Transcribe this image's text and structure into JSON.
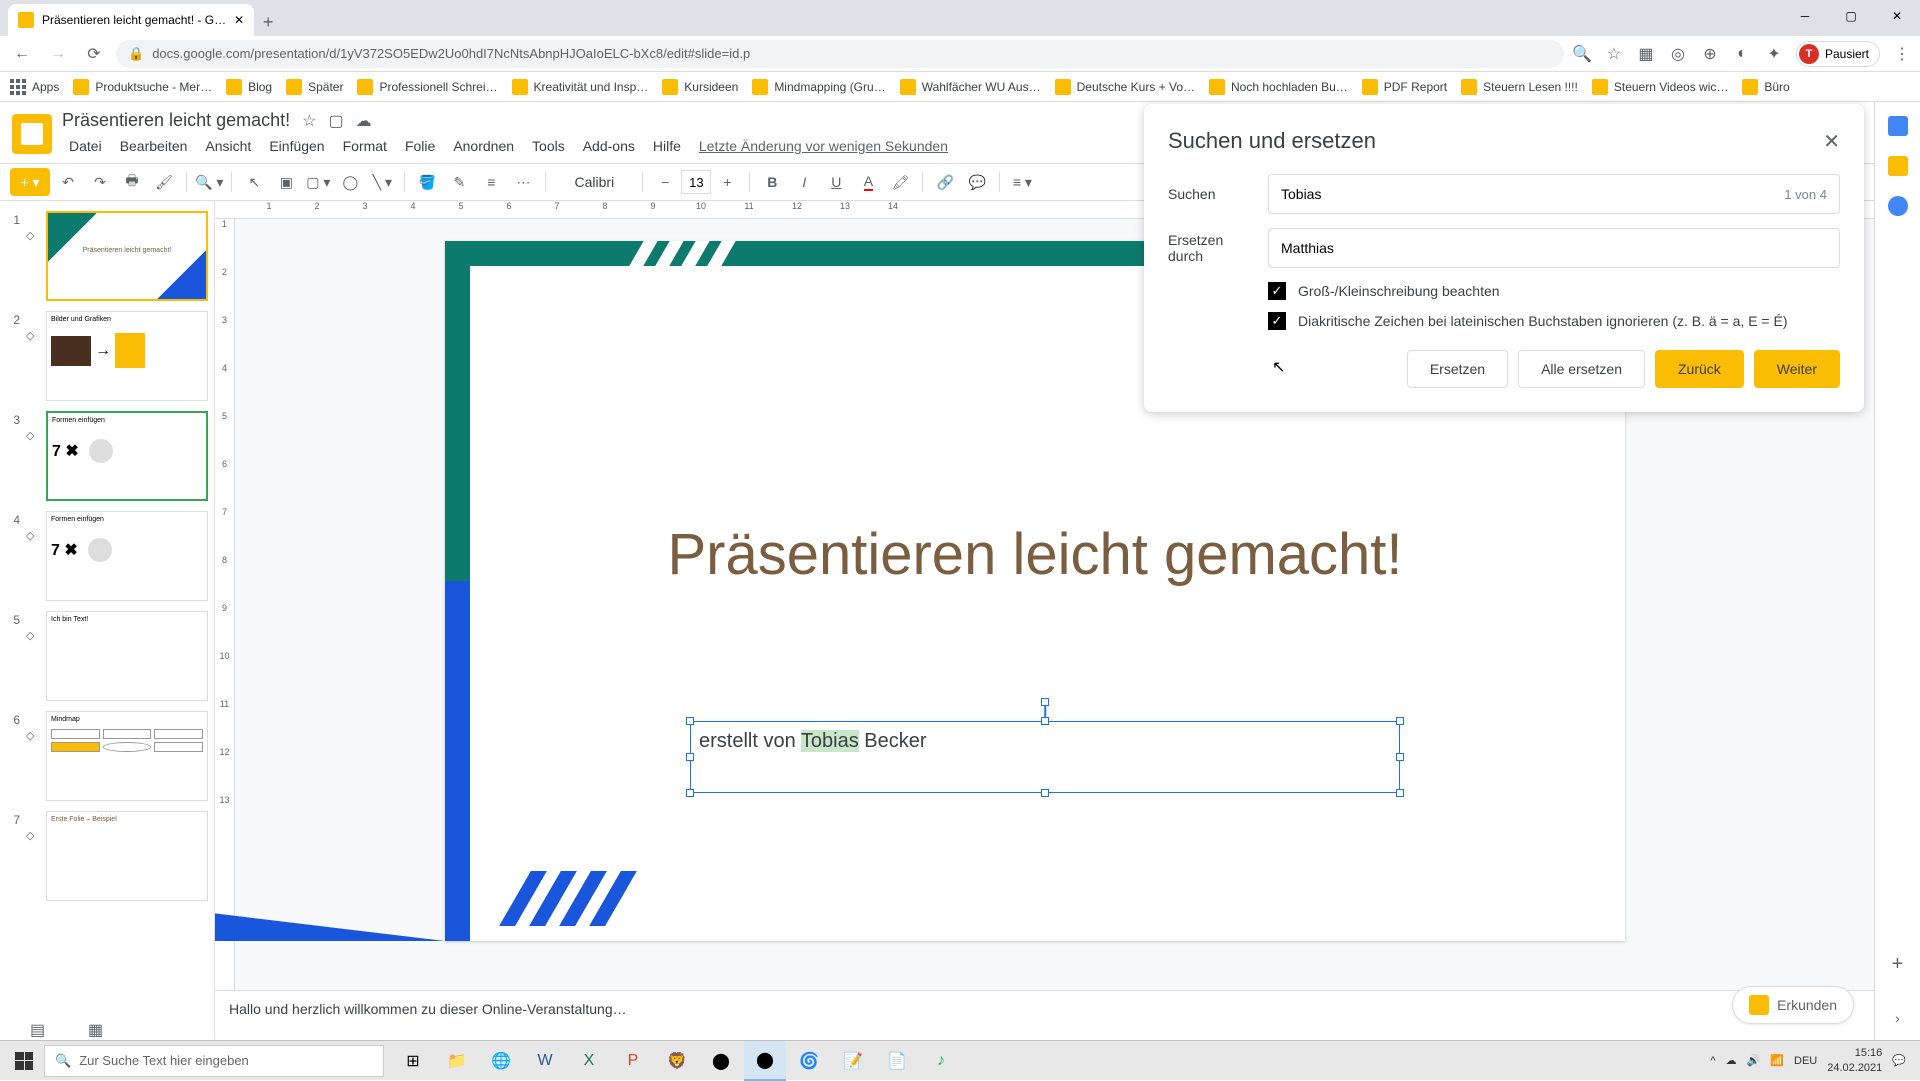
{
  "browser": {
    "tab_title": "Präsentieren leicht gemacht! - G…",
    "url": "docs.google.com/presentation/d/1yV372SO5EDw2Uo0hdI7NcNtsAbnpHJOaIoELC-bXc8/edit#slide=id.p",
    "pausiert": "Pausiert"
  },
  "bookmarks": [
    "Apps",
    "Produktsuche - Mer…",
    "Blog",
    "Später",
    "Professionell Schrei…",
    "Kreativität und Insp…",
    "Kursideen",
    "Mindmapping  (Gru…",
    "Wahlfächer WU Aus…",
    "Deutsche Kurs + Vo…",
    "Noch hochladen Bu…",
    "PDF Report",
    "Steuern Lesen !!!!",
    "Steuern Videos wic…",
    "Büro"
  ],
  "app": {
    "title": "Präsentieren leicht gemacht!",
    "last_edit": "Letzte Änderung vor wenigen Sekunden"
  },
  "menu": [
    "Datei",
    "Bearbeiten",
    "Ansicht",
    "Einfügen",
    "Format",
    "Folie",
    "Anordnen",
    "Tools",
    "Add-ons",
    "Hilfe"
  ],
  "toolbar": {
    "font": "Calibri",
    "font_size": "13"
  },
  "slide": {
    "title": "Präsentieren leicht gemacht!",
    "subtitle_pre": "erstellt von ",
    "subtitle_highlight": "Tobias",
    "subtitle_post": " Becker"
  },
  "notes": "Hallo und herzlich willkommen zu dieser Online-Veranstaltung…",
  "dialog": {
    "title": "Suchen und ersetzen",
    "search_label": "Suchen",
    "search_value": "Tobias",
    "match_count": "1 von 4",
    "replace_label": "Ersetzen durch",
    "replace_value": "Matthias",
    "check1": "Groß-/Kleinschreibung beachten",
    "check2": "Diakritische Zeichen bei lateinischen Buchstaben ignorieren (z. B. ä = a, E = É)",
    "btn_replace": "Ersetzen",
    "btn_replace_all": "Alle ersetzen",
    "btn_back": "Zurück",
    "btn_next": "Weiter"
  },
  "explore": "Erkunden",
  "thumbs": {
    "t1": "Präsentieren leicht gemacht!",
    "t2": "Bilder und Grafiken",
    "t3": "Formen einfügen",
    "t3b": "7 ✖",
    "t4": "Formen einfügen",
    "t4b": "7 ✖",
    "t5": "Ich bin Text!",
    "t6": "Mindmap",
    "t7": "Erste Folie – Beispiel"
  },
  "taskbar": {
    "search_placeholder": "Zur Suche Text hier eingeben",
    "lang": "DEU",
    "time": "15:16",
    "date": "24.02.2021"
  }
}
